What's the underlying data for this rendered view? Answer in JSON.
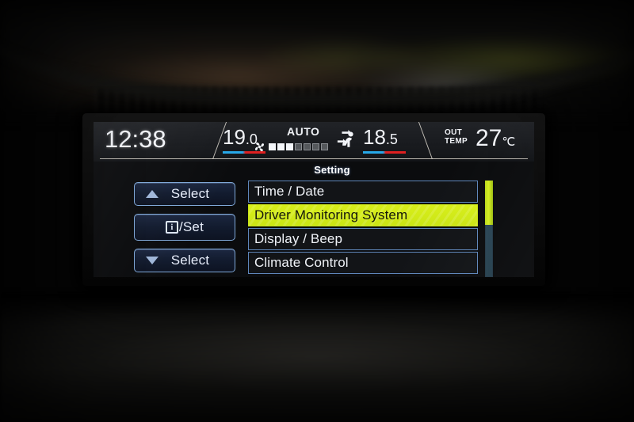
{
  "device": {
    "name": "vehicle-multi-function-display",
    "screen_label": "MFD"
  },
  "status_bar": {
    "clock": "12:38",
    "driver_temp": {
      "whole": "19",
      "decimal": ".0"
    },
    "passenger_temp": {
      "whole": "18",
      "decimal": ".5"
    },
    "auto_label": "AUTO",
    "fan": {
      "icon": "fan-icon",
      "level": 3,
      "max": 7
    },
    "airflow_icon": "airflow-face-feet-icon",
    "outside_temp": {
      "label_line1": "OUT",
      "label_line2": "TEMP",
      "value": "27",
      "unit": "℃"
    }
  },
  "menu": {
    "title": "Setting",
    "items": [
      {
        "label": "Time / Date",
        "selected": false
      },
      {
        "label": "Driver Monitoring System",
        "selected": true
      },
      {
        "label": "Display / Beep",
        "selected": false
      },
      {
        "label": "Climate Control",
        "selected": false
      }
    ],
    "scroll": {
      "thumb_percent": 46,
      "position_percent": 0
    }
  },
  "buttons": {
    "select_up": {
      "label": "Select",
      "arrow": "up-arrow-icon"
    },
    "set": {
      "label": "/Set",
      "glyph": "i",
      "icon": "info-icon"
    },
    "select_down": {
      "label": "Select",
      "arrow": "down-arrow-icon"
    }
  },
  "colors": {
    "highlight": "#d8ef1a",
    "row_border": "#5f87bb",
    "button_border": "#7fa8d8",
    "screen_bg": "#0b0c0e",
    "cold": "#27a8e8",
    "hot": "#e02020"
  }
}
